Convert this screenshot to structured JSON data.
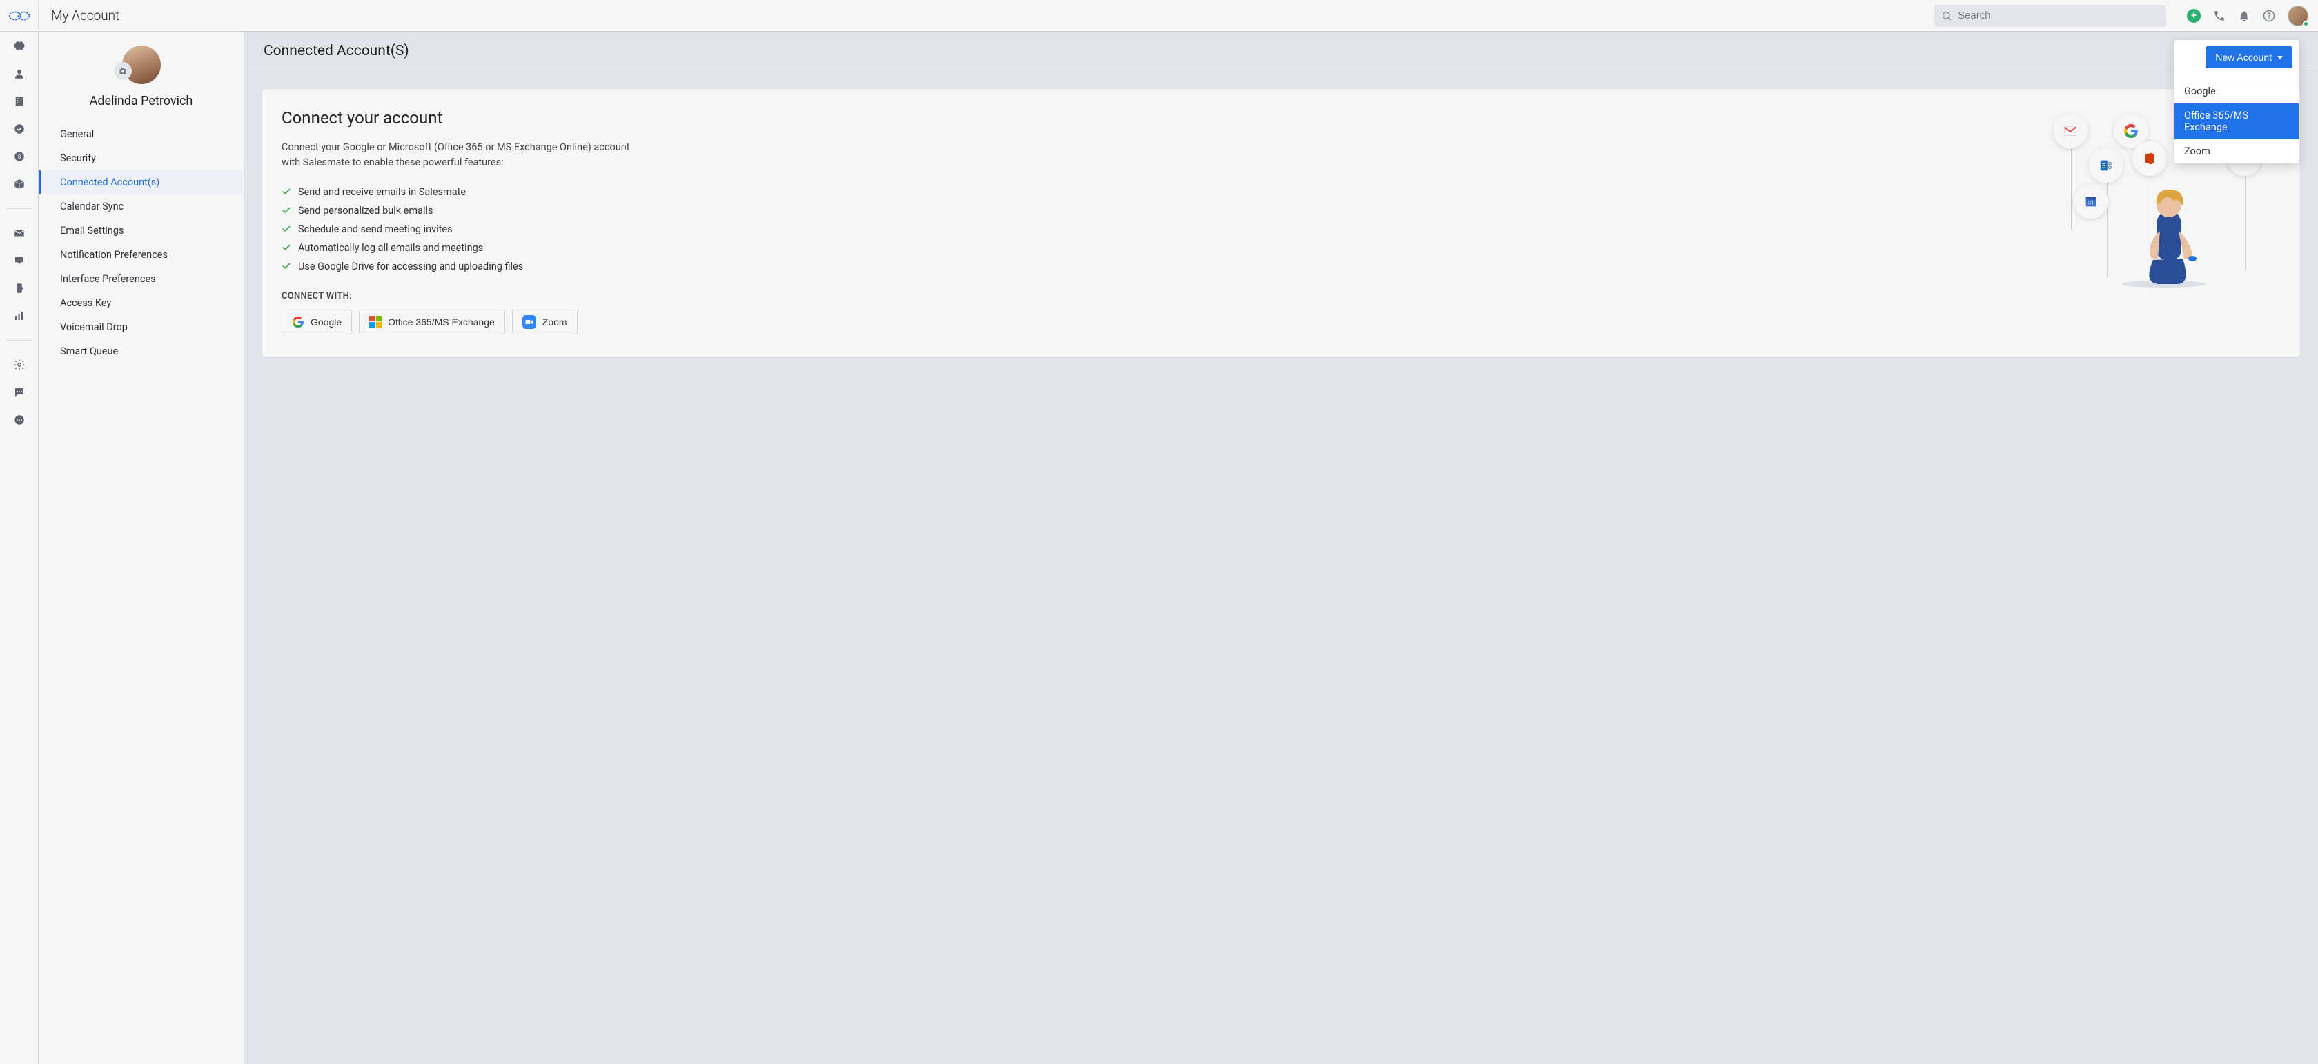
{
  "header": {
    "title": "My Account",
    "search_placeholder": "Search"
  },
  "profile": {
    "name": "Adelinda Petrovich"
  },
  "sideNav": {
    "items": [
      {
        "label": "General"
      },
      {
        "label": "Security"
      },
      {
        "label": "Connected Account(s)",
        "active": true
      },
      {
        "label": "Calendar Sync"
      },
      {
        "label": "Email Settings"
      },
      {
        "label": "Notification Preferences"
      },
      {
        "label": "Interface Preferences"
      },
      {
        "label": "Access Key"
      },
      {
        "label": "Voicemail Drop"
      },
      {
        "label": "Smart Queue"
      }
    ]
  },
  "page": {
    "heading": "Connected Account(S)",
    "new_account_btn": "New Account"
  },
  "card": {
    "title": "Connect your account",
    "description": "Connect your Google or Microsoft (Office 365 or MS Exchange Online) account with Salesmate to enable these powerful features:",
    "features": [
      "Send and receive emails in Salesmate",
      "Send personalized bulk emails",
      "Schedule and send meeting invites",
      "Automatically log all emails and meetings",
      "Use Google Drive for accessing and uploading files"
    ],
    "connect_with_label": "CONNECT WITH:",
    "providers": {
      "google": "Google",
      "office": "Office 365/MS Exchange",
      "zoom": "Zoom"
    }
  },
  "dropdown": {
    "items": [
      {
        "label": "Google"
      },
      {
        "label": "Office 365/MS Exchange",
        "hover": true
      },
      {
        "label": "Zoom"
      }
    ]
  }
}
